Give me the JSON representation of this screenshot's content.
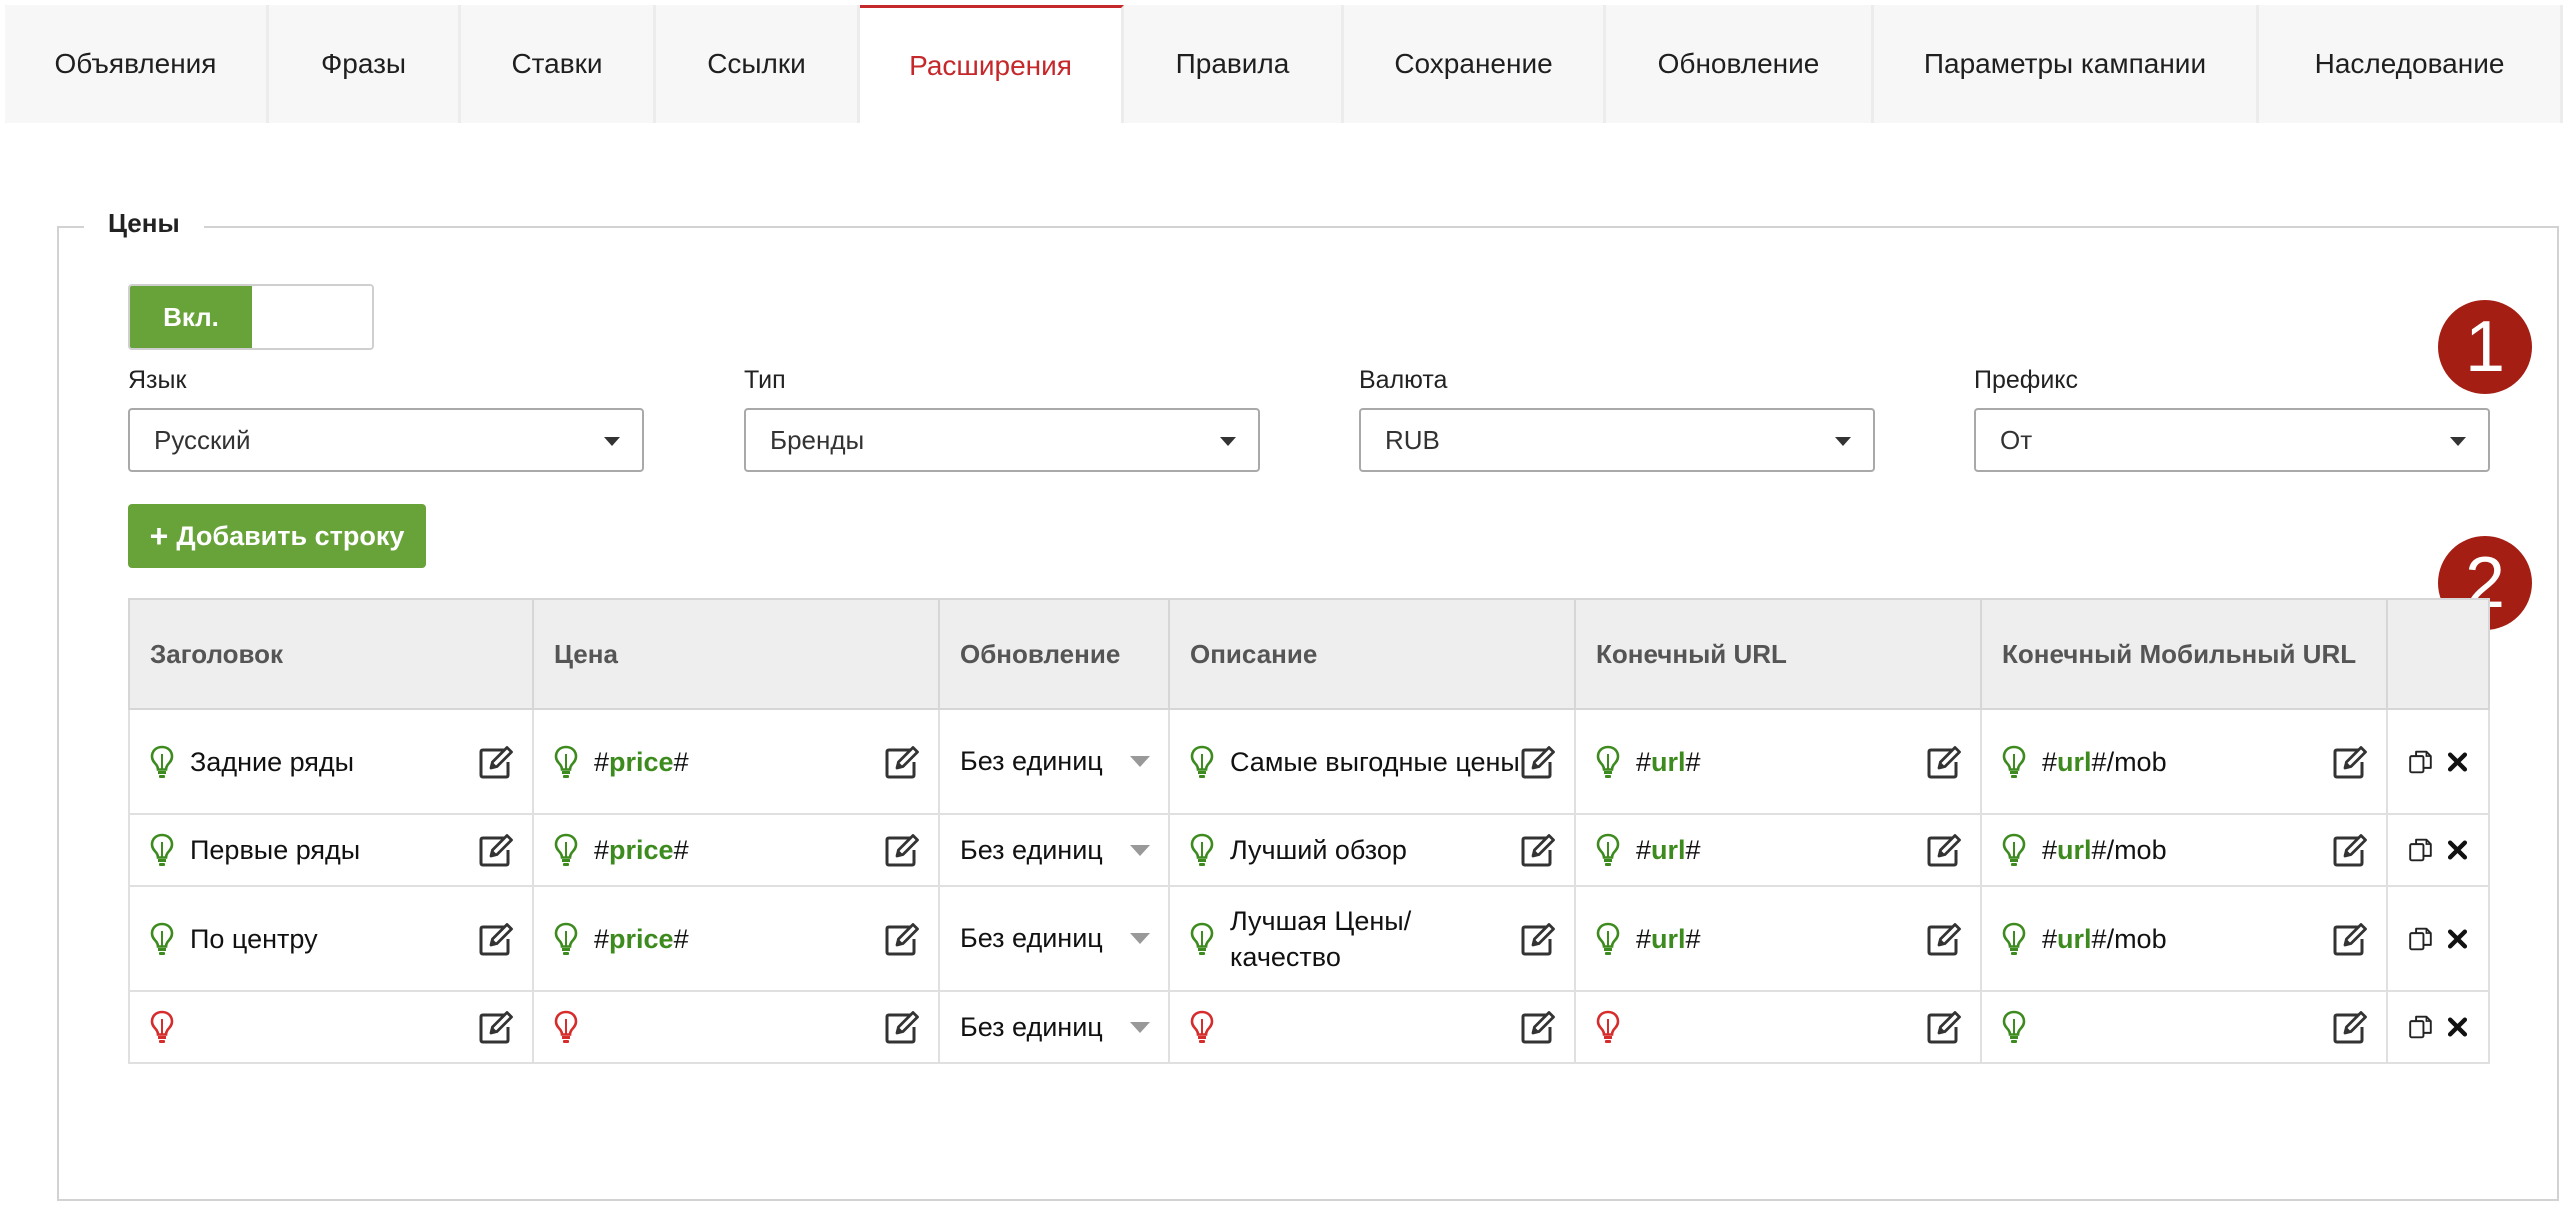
{
  "tabs": [
    {
      "label": "Объявления",
      "width": 264
    },
    {
      "label": "Фразы",
      "width": 192
    },
    {
      "label": "Ставки",
      "width": 195
    },
    {
      "label": "Ссылки",
      "width": 204
    },
    {
      "label": "Расширения",
      "width": 264,
      "active": true
    },
    {
      "label": "Правила",
      "width": 220
    },
    {
      "label": "Сохранение",
      "width": 262
    },
    {
      "label": "Обновление",
      "width": 268
    },
    {
      "label": "Параметры кампании",
      "width": 385
    },
    {
      "label": "Наследование",
      "width": 304
    }
  ],
  "section": {
    "title": "Цены"
  },
  "toggle": {
    "on_label": "Вкл."
  },
  "fields": {
    "language": {
      "label": "Язык",
      "value": "Русский"
    },
    "type": {
      "label": "Тип",
      "value": "Бренды"
    },
    "currency": {
      "label": "Валюта",
      "value": "RUB"
    },
    "prefix": {
      "label": "Префикс",
      "value": "От"
    }
  },
  "badges": [
    "1",
    "2"
  ],
  "add_row_label": "Добавить строку",
  "table": {
    "headers": [
      "Заголовок",
      "Цена",
      "Обновление",
      "Описание",
      "Конечный URL",
      "Конечный Мобильный URL"
    ],
    "rows": [
      {
        "title": "Задние ряды",
        "price_pre": "#",
        "price_var": "price",
        "price_post": "#",
        "unit": "Без единиц",
        "desc": "Самые выгодные цены",
        "url_pre": "#",
        "url_var": "url",
        "url_post": "#",
        "murl_pre": "#",
        "murl_var": "url",
        "murl_post": "#/mob"
      },
      {
        "title": "Первые ряды",
        "price_pre": "#",
        "price_var": "price",
        "price_post": "#",
        "unit": "Без единиц",
        "desc": "Лучший обзор",
        "url_pre": "#",
        "url_var": "url",
        "url_post": "#",
        "murl_pre": "#",
        "murl_var": "url",
        "murl_post": "#/mob"
      },
      {
        "title": "По центру",
        "price_pre": "#",
        "price_var": "price",
        "price_post": "#",
        "unit": "Без единиц",
        "desc": "Лучшая Цены/качество",
        "url_pre": "#",
        "url_var": "url",
        "url_post": "#",
        "murl_pre": "#",
        "murl_var": "url",
        "murl_post": "#/mob"
      },
      {
        "title": "",
        "price_pre": "",
        "price_var": "",
        "price_post": "",
        "unit": "Без единиц",
        "desc": "",
        "url_pre": "",
        "url_var": "",
        "url_post": "",
        "murl_pre": "",
        "murl_var": "",
        "murl_post": ""
      }
    ]
  },
  "colors": {
    "accent": "#c5282b",
    "green": "#68a33a",
    "valid": "#3d8b1e",
    "invalid": "#d62c2c",
    "badge": "#a41e13"
  }
}
